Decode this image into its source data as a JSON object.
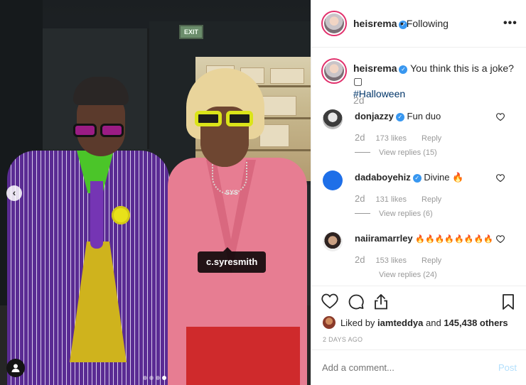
{
  "photo": {
    "exit_sign": "EXIT",
    "tag_tooltip": "c.syresmith",
    "pendant_text": "SYS",
    "prev_icon": "chevron-left-icon",
    "user_tag_icon": "user-icon",
    "carousel": {
      "count": 4,
      "active_index": 3
    }
  },
  "header": {
    "username": "heisrema",
    "verified": true,
    "separator": "•",
    "follow_status": "Following",
    "more_label": "•••"
  },
  "caption": {
    "username": "heisrema",
    "text": "You think this is a joke? ▢",
    "hashtag": "#Halloween",
    "time": "2d"
  },
  "comments": [
    {
      "username": "donjazzy",
      "verified": true,
      "text": "Fun duo",
      "time": "2d",
      "likes": "173 likes",
      "reply": "Reply",
      "view_replies": "View replies (15)"
    },
    {
      "username": "dadaboyehiz",
      "verified": true,
      "text": "Divine 🔥",
      "time": "2d",
      "likes": "131 likes",
      "reply": "Reply",
      "view_replies": "View replies (6)"
    },
    {
      "username": "naiiramarrley",
      "verified": false,
      "text": "🔥🔥🔥🔥🔥🔥🔥🔥",
      "time": "2d",
      "likes": "153 likes",
      "reply": "Reply",
      "view_replies": "View replies (24)"
    }
  ],
  "actions": {
    "liked_prefix": "Liked by",
    "liked_user": "iamteddya",
    "liked_and": "and",
    "liked_count": "145,438 others",
    "timestamp": "2 DAYS AGO"
  },
  "add_comment": {
    "placeholder": "Add a comment...",
    "post_label": "Post"
  },
  "colors": {
    "verified": "#3897f0",
    "post_disabled": "#b2dffc",
    "hashtag": "#003569",
    "meta": "#999999"
  }
}
